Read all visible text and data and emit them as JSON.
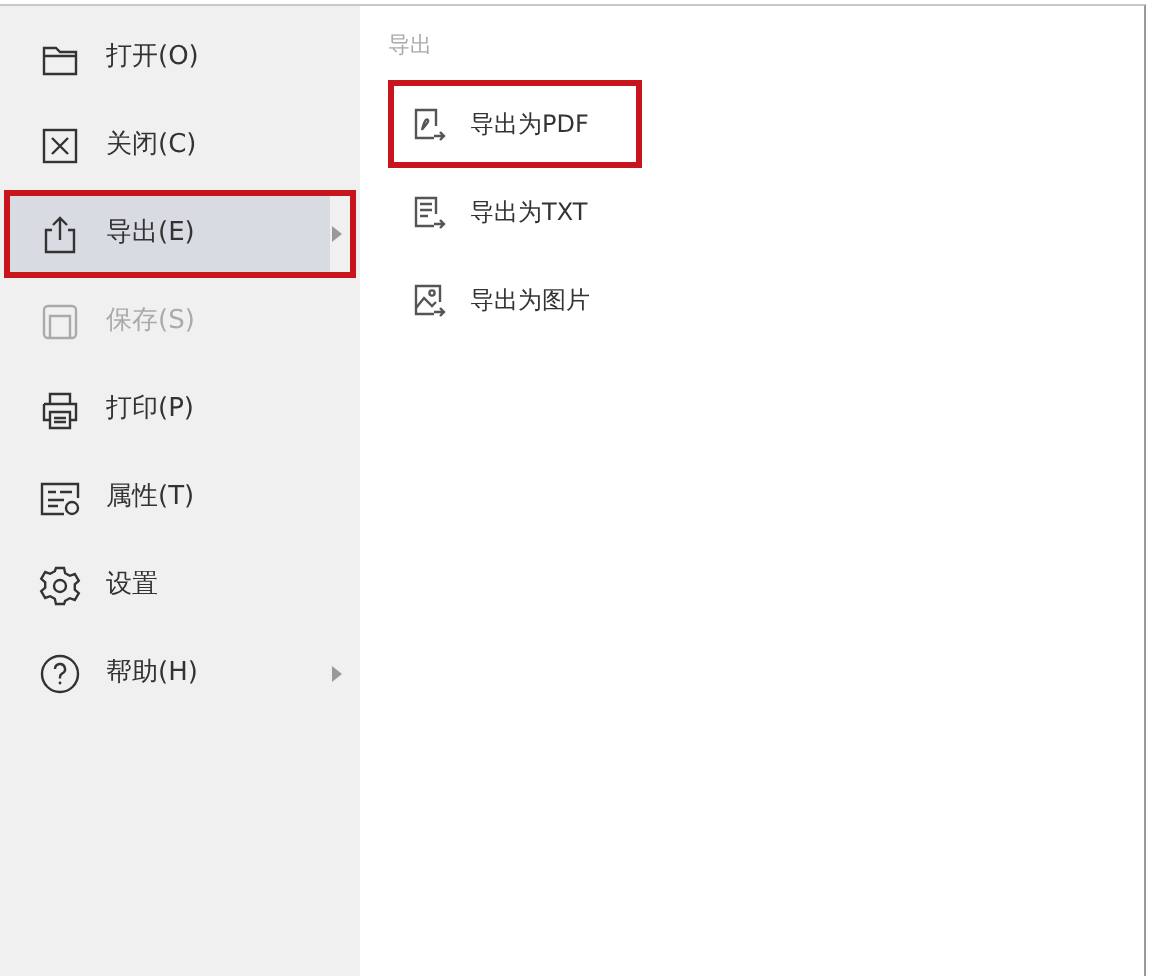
{
  "menu": [
    {
      "label": "打开(O)",
      "selected": false,
      "disabled": false,
      "has_submenu": false,
      "highlighted": false
    },
    {
      "label": "关闭(C)",
      "selected": false,
      "disabled": false,
      "has_submenu": false,
      "highlighted": false
    },
    {
      "label": "导出(E)",
      "selected": true,
      "disabled": false,
      "has_submenu": true,
      "highlighted": true
    },
    {
      "label": "保存(S)",
      "selected": false,
      "disabled": true,
      "has_submenu": false,
      "highlighted": false
    },
    {
      "label": "打印(P)",
      "selected": false,
      "disabled": false,
      "has_submenu": false,
      "highlighted": false
    },
    {
      "label": "属性(T)",
      "selected": false,
      "disabled": false,
      "has_submenu": false,
      "highlighted": false
    },
    {
      "label": "设置",
      "selected": false,
      "disabled": false,
      "has_submenu": false,
      "highlighted": false
    },
    {
      "label": "帮助(H)",
      "selected": false,
      "disabled": false,
      "has_submenu": true,
      "highlighted": false
    }
  ],
  "submenu": {
    "title": "导出",
    "items": [
      {
        "label": "导出为PDF",
        "highlighted": true
      },
      {
        "label": "导出为TXT",
        "highlighted": false
      },
      {
        "label": "导出为图片",
        "highlighted": false
      }
    ]
  }
}
